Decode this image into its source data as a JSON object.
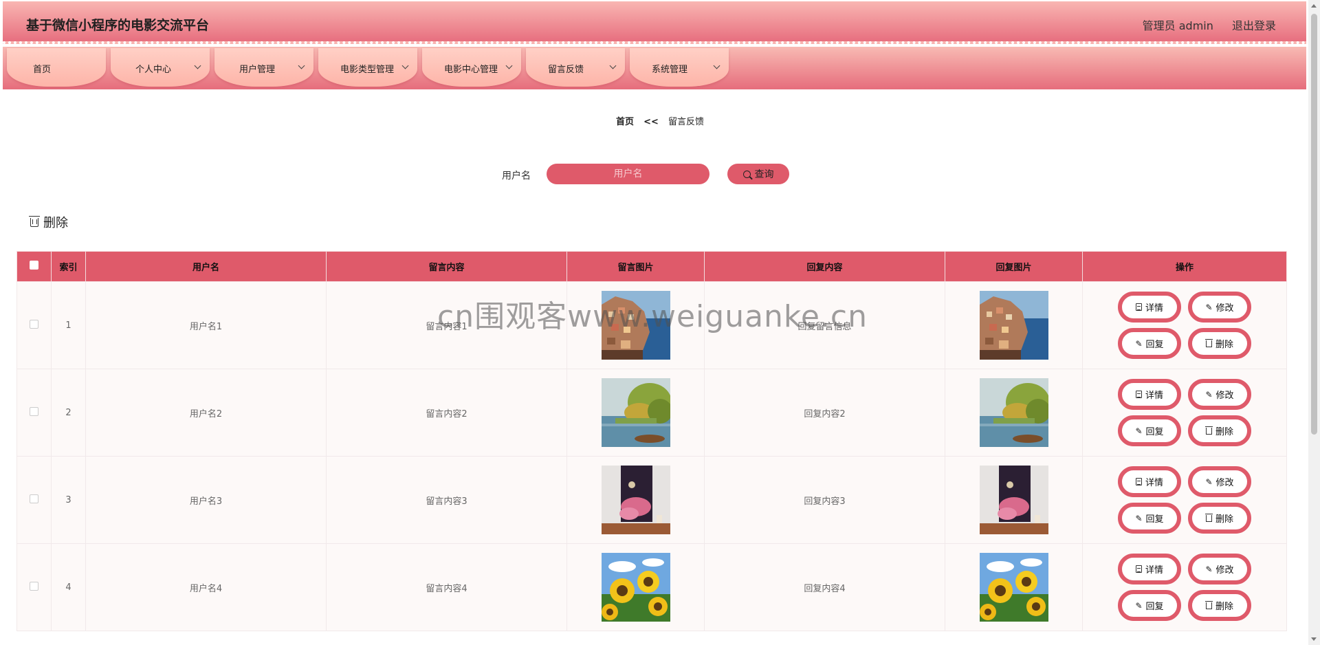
{
  "header": {
    "title": "基于微信小程序的电影交流平台",
    "user": "管理员 admin",
    "logout": "退出登录"
  },
  "nav": [
    {
      "label": "首页",
      "dropdown": false
    },
    {
      "label": "个人中心",
      "dropdown": true
    },
    {
      "label": "用户管理",
      "dropdown": true
    },
    {
      "label": "电影类型管理",
      "dropdown": true
    },
    {
      "label": "电影中心管理",
      "dropdown": true
    },
    {
      "label": "留言反馈",
      "dropdown": true
    },
    {
      "label": "系统管理",
      "dropdown": true
    }
  ],
  "breadcrumb": {
    "home": "首页",
    "sep": "<<",
    "current": "留言反馈"
  },
  "search": {
    "label": "用户名",
    "placeholder": "用户名",
    "button": "查询"
  },
  "batch_delete": "删除",
  "table": {
    "headers": [
      "索引",
      "用户名",
      "留言内容",
      "留言图片",
      "回复内容",
      "回复图片",
      "操作"
    ],
    "rows": [
      {
        "index": "1",
        "username": "用户名1",
        "content": "留言内容1",
        "image": "coastal-village-photo",
        "reply": "回复留言信息",
        "reply_image": "coastal-village-photo"
      },
      {
        "index": "2",
        "username": "用户名2",
        "content": "留言内容2",
        "image": "lake-painting",
        "reply": "回复内容2",
        "reply_image": "lake-painting"
      },
      {
        "index": "3",
        "username": "用户名3",
        "content": "留言内容3",
        "image": "pink-clouds-poster",
        "reply": "回复内容3",
        "reply_image": "pink-clouds-poster"
      },
      {
        "index": "4",
        "username": "用户名4",
        "content": "留言内容4",
        "image": "sunflowers-photo",
        "reply": "回复内容4",
        "reply_image": "sunflowers-photo"
      }
    ],
    "actions": {
      "detail": "详情",
      "edit": "修改",
      "reply": "回复",
      "delete": "删除"
    }
  },
  "watermark": "cn围观客www.weiguanke.cn",
  "colors": {
    "accent": "#df5a6a",
    "nav_pill": "#fdb4a8",
    "header_top": "#f9b6b2",
    "header_bottom": "#e76f7f"
  }
}
